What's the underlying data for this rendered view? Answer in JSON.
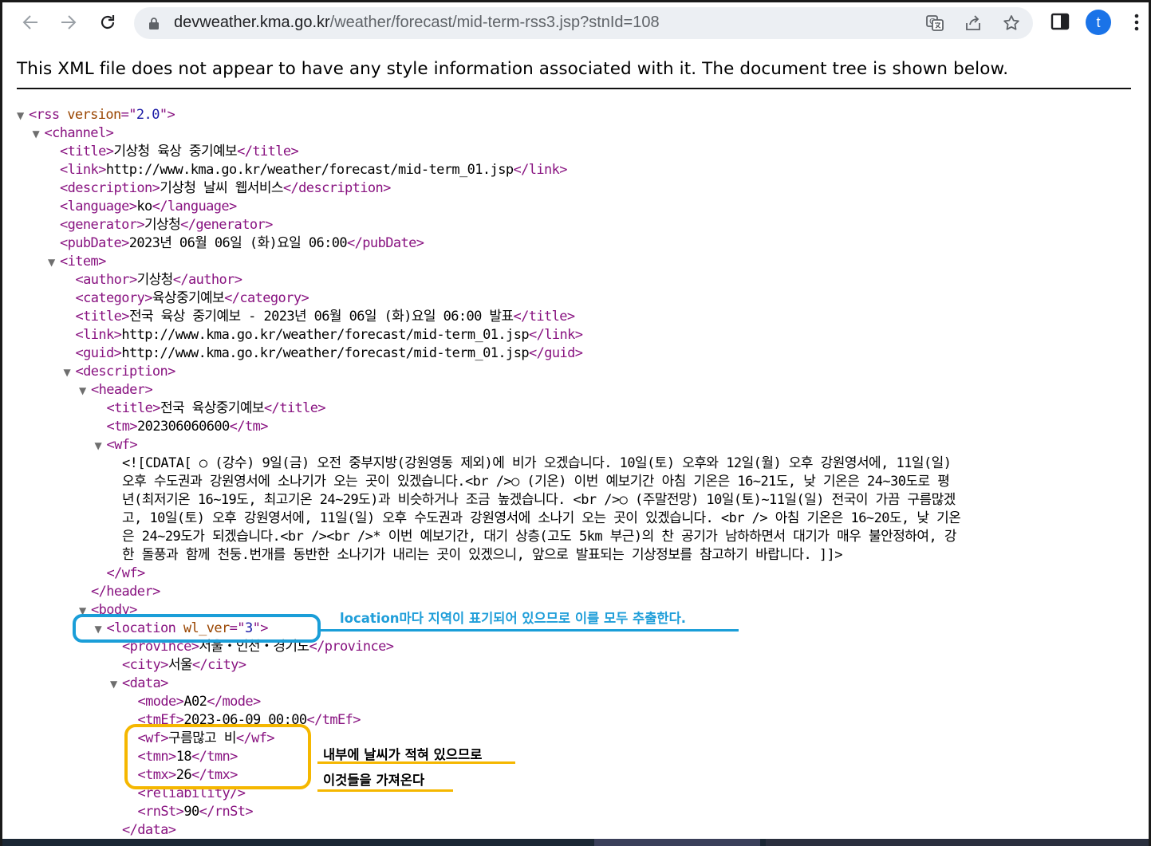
{
  "browser": {
    "url_host": "devweather.kma.go.kr",
    "url_path": "/weather/forecast/mid-term-rss3.jsp?stnId=108",
    "profile_initial": "t"
  },
  "page": {
    "notice": "This XML file does not appear to have any style information associated with it. The document tree is shown below."
  },
  "xml_lines": [
    {
      "indent": 0,
      "toggle": true,
      "parts": [
        [
          "tag",
          "<rss "
        ],
        [
          "attr-name",
          "version"
        ],
        [
          "tag",
          "=\""
        ],
        [
          "attr-val",
          "2.0"
        ],
        [
          "tag",
          "\">"
        ]
      ]
    },
    {
      "indent": 1,
      "toggle": true,
      "parts": [
        [
          "tag",
          "<channel>"
        ]
      ]
    },
    {
      "indent": 2,
      "toggle": false,
      "parts": [
        [
          "tag",
          "<title>"
        ],
        [
          "text",
          "기상청 육상 중기예보"
        ],
        [
          "tag",
          "</title>"
        ]
      ]
    },
    {
      "indent": 2,
      "toggle": false,
      "parts": [
        [
          "tag",
          "<link>"
        ],
        [
          "text",
          "http://www.kma.go.kr/weather/forecast/mid-term_01.jsp"
        ],
        [
          "tag",
          "</link>"
        ]
      ]
    },
    {
      "indent": 2,
      "toggle": false,
      "parts": [
        [
          "tag",
          "<description>"
        ],
        [
          "text",
          "기상청 날씨 웹서비스"
        ],
        [
          "tag",
          "</description>"
        ]
      ]
    },
    {
      "indent": 2,
      "toggle": false,
      "parts": [
        [
          "tag",
          "<language>"
        ],
        [
          "text",
          "ko"
        ],
        [
          "tag",
          "</language>"
        ]
      ]
    },
    {
      "indent": 2,
      "toggle": false,
      "parts": [
        [
          "tag",
          "<generator>"
        ],
        [
          "text",
          "기상청"
        ],
        [
          "tag",
          "</generator>"
        ]
      ]
    },
    {
      "indent": 2,
      "toggle": false,
      "parts": [
        [
          "tag",
          "<pubDate>"
        ],
        [
          "text",
          "2023년 06월 06일 (화)요일 06:00"
        ],
        [
          "tag",
          "</pubDate>"
        ]
      ]
    },
    {
      "indent": 2,
      "toggle": true,
      "parts": [
        [
          "tag",
          "<item>"
        ]
      ]
    },
    {
      "indent": 3,
      "toggle": false,
      "parts": [
        [
          "tag",
          "<author>"
        ],
        [
          "text",
          "기상청"
        ],
        [
          "tag",
          "</author>"
        ]
      ]
    },
    {
      "indent": 3,
      "toggle": false,
      "parts": [
        [
          "tag",
          "<category>"
        ],
        [
          "text",
          "육상중기예보"
        ],
        [
          "tag",
          "</category>"
        ]
      ]
    },
    {
      "indent": 3,
      "toggle": false,
      "parts": [
        [
          "tag",
          "<title>"
        ],
        [
          "text",
          "전국 육상 중기예보 - 2023년 06월 06일 (화)요일 06:00 발표"
        ],
        [
          "tag",
          "</title>"
        ]
      ]
    },
    {
      "indent": 3,
      "toggle": false,
      "parts": [
        [
          "tag",
          "<link>"
        ],
        [
          "text",
          "http://www.kma.go.kr/weather/forecast/mid-term_01.jsp"
        ],
        [
          "tag",
          "</link>"
        ]
      ]
    },
    {
      "indent": 3,
      "toggle": false,
      "parts": [
        [
          "tag",
          "<guid>"
        ],
        [
          "text",
          "http://www.kma.go.kr/weather/forecast/mid-term_01.jsp"
        ],
        [
          "tag",
          "</guid>"
        ]
      ]
    },
    {
      "indent": 3,
      "toggle": true,
      "parts": [
        [
          "tag",
          "<description>"
        ]
      ]
    },
    {
      "indent": 4,
      "toggle": true,
      "parts": [
        [
          "tag",
          "<header>"
        ]
      ]
    },
    {
      "indent": 5,
      "toggle": false,
      "parts": [
        [
          "tag",
          "<title>"
        ],
        [
          "text",
          "전국 육상중기예보"
        ],
        [
          "tag",
          "</title>"
        ]
      ]
    },
    {
      "indent": 5,
      "toggle": false,
      "parts": [
        [
          "tag",
          "<tm>"
        ],
        [
          "text",
          "202306060600"
        ],
        [
          "tag",
          "</tm>"
        ]
      ]
    },
    {
      "indent": 5,
      "toggle": true,
      "parts": [
        [
          "tag",
          "<wf>"
        ]
      ]
    },
    {
      "indent": 6,
      "toggle": false,
      "wrap": true,
      "parts": [
        [
          "text",
          "<![CDATA[ ○ (강수) 9일(금) 오전 중부지방(강원영동 제외)에 비가 오겠습니다. 10일(토) 오후와 12일(월) 오후 강원영서에, 11일(일)"
        ]
      ]
    },
    {
      "indent": 6,
      "toggle": false,
      "wrap": true,
      "parts": [
        [
          "text",
          "오후 수도권과 강원영서에 소나기가 오는 곳이 있겠습니다.<br />○ (기온) 이번 예보기간 아침 기온은 16~21도, 낮 기온은 24~30도로 평"
        ]
      ]
    },
    {
      "indent": 6,
      "toggle": false,
      "wrap": true,
      "parts": [
        [
          "text",
          "년(최저기온 16~19도, 최고기온 24~29도)과 비슷하거나 조금 높겠습니다. <br />○ (주말전망) 10일(토)~11일(일) 전국이 가끔 구름많겠"
        ]
      ]
    },
    {
      "indent": 6,
      "toggle": false,
      "wrap": true,
      "parts": [
        [
          "text",
          "고, 10일(토) 오후 강원영서에, 11일(일) 오후 수도권과 강원영서에 소나기 오는 곳이 있겠습니다. <br /> 아침 기온은 16~20도, 낮 기온"
        ]
      ]
    },
    {
      "indent": 6,
      "toggle": false,
      "wrap": true,
      "parts": [
        [
          "text",
          "은 24~29도가 되겠습니다.<br /><br />* 이번 예보기간, 대기 상층(고도 5km 부근)의 찬 공기가 남하하면서 대기가 매우 불안정하여, 강"
        ]
      ]
    },
    {
      "indent": 6,
      "toggle": false,
      "wrap": true,
      "parts": [
        [
          "text",
          "한 돌풍과 함께 천둥.번개를 동반한 소나기가 내리는 곳이 있겠으니, 앞으로 발표되는 기상정보를 참고하기 바랍니다. ]]>"
        ]
      ]
    },
    {
      "indent": 5,
      "toggle": false,
      "parts": [
        [
          "tag",
          "</wf>"
        ]
      ]
    },
    {
      "indent": 4,
      "toggle": false,
      "parts": [
        [
          "tag",
          "</header>"
        ]
      ]
    },
    {
      "indent": 4,
      "toggle": true,
      "parts": [
        [
          "tag",
          "<body>"
        ]
      ]
    },
    {
      "indent": 5,
      "toggle": true,
      "parts": [
        [
          "tag",
          "<location "
        ],
        [
          "attr-name",
          "wl_ver"
        ],
        [
          "tag",
          "=\""
        ],
        [
          "attr-val",
          "3"
        ],
        [
          "tag",
          "\">"
        ]
      ]
    },
    {
      "indent": 6,
      "toggle": false,
      "parts": [
        [
          "tag",
          "<province>"
        ],
        [
          "text",
          "서울・인천・경기도"
        ],
        [
          "tag",
          "</province>"
        ]
      ]
    },
    {
      "indent": 6,
      "toggle": false,
      "parts": [
        [
          "tag",
          "<city>"
        ],
        [
          "text",
          "서울"
        ],
        [
          "tag",
          "</city>"
        ]
      ]
    },
    {
      "indent": 6,
      "toggle": true,
      "parts": [
        [
          "tag",
          "<data>"
        ]
      ]
    },
    {
      "indent": 7,
      "toggle": false,
      "parts": [
        [
          "tag",
          "<mode>"
        ],
        [
          "text",
          "A02"
        ],
        [
          "tag",
          "</mode>"
        ]
      ]
    },
    {
      "indent": 7,
      "toggle": false,
      "parts": [
        [
          "tag",
          "<tmEf>"
        ],
        [
          "text",
          "2023-06-09 00:00"
        ],
        [
          "tag",
          "</tmEf>"
        ]
      ]
    },
    {
      "indent": 7,
      "toggle": false,
      "parts": [
        [
          "tag",
          "<wf>"
        ],
        [
          "text",
          "구름많고 비"
        ],
        [
          "tag",
          "</wf>"
        ]
      ]
    },
    {
      "indent": 7,
      "toggle": false,
      "parts": [
        [
          "tag",
          "<tmn>"
        ],
        [
          "text",
          "18"
        ],
        [
          "tag",
          "</tmn>"
        ]
      ]
    },
    {
      "indent": 7,
      "toggle": false,
      "parts": [
        [
          "tag",
          "<tmx>"
        ],
        [
          "text",
          "26"
        ],
        [
          "tag",
          "</tmx>"
        ]
      ]
    },
    {
      "indent": 7,
      "toggle": false,
      "parts": [
        [
          "tag",
          "<reliability/>"
        ]
      ]
    },
    {
      "indent": 7,
      "toggle": false,
      "parts": [
        [
          "tag",
          "<rnSt>"
        ],
        [
          "text",
          "90"
        ],
        [
          "tag",
          "</rnSt>"
        ]
      ]
    },
    {
      "indent": 6,
      "toggle": false,
      "parts": [
        [
          "tag",
          "</data>"
        ]
      ]
    }
  ],
  "annotations": {
    "location_note": "location마다 지역이 표기되어 있으므로 이를 모두 추출한다.",
    "weather_note_1": "내부에 날씨가 적혀 있으므로",
    "weather_note_2": "이것들을 가져온다",
    "blue_color": "#1a9ed8",
    "yellow_color": "#f5b700"
  }
}
